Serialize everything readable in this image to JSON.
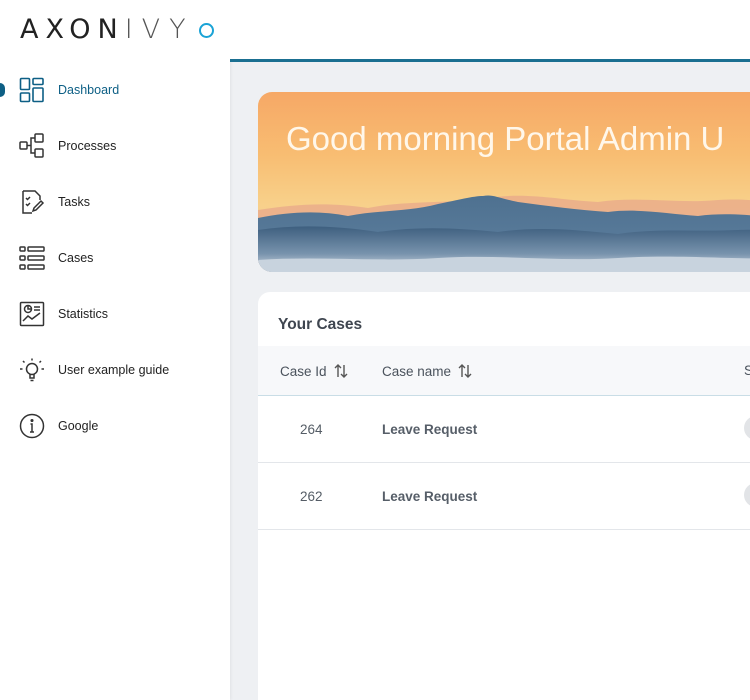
{
  "app": {
    "logo_text": "AXONIVY",
    "accent_color": "#0d5f85",
    "logo_accent": "#1aa3d6"
  },
  "sidebar": {
    "items": [
      {
        "label": "Dashboard",
        "icon": "dashboard-icon",
        "active": true
      },
      {
        "label": "Processes",
        "icon": "processes-icon"
      },
      {
        "label": "Tasks",
        "icon": "tasks-icon"
      },
      {
        "label": "Cases",
        "icon": "cases-icon"
      },
      {
        "label": "Statistics",
        "icon": "statistics-icon"
      },
      {
        "label": "User example guide",
        "icon": "lightbulb-icon"
      },
      {
        "label": "Google",
        "icon": "info-icon"
      }
    ]
  },
  "banner": {
    "greeting": "Good morning Portal Admin U"
  },
  "cases": {
    "title": "Your Cases",
    "columns": [
      {
        "label": "Case Id",
        "sortable": true
      },
      {
        "label": "Case name",
        "sortable": true
      },
      {
        "label": "S",
        "sortable": false
      }
    ],
    "rows": [
      {
        "id": "264",
        "name": "Leave Request"
      },
      {
        "id": "262",
        "name": "Leave Request"
      }
    ]
  }
}
